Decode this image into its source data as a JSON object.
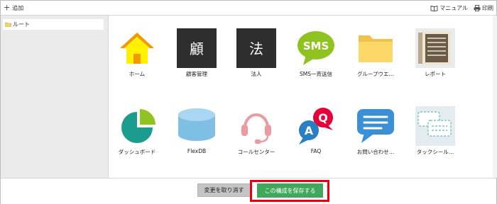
{
  "toolbar": {
    "add_label": "追加",
    "manual_label": "マニュアル",
    "print_label": "印刷"
  },
  "sidebar": {
    "root_label": "ルート"
  },
  "apps": [
    {
      "label": "ホーム",
      "icon": "house-icon"
    },
    {
      "label": "顧客管理",
      "icon": "customer-kanji-icon",
      "glyph": "顧"
    },
    {
      "label": "法人",
      "icon": "corporate-kanji-icon",
      "glyph": "法"
    },
    {
      "label": "SMS一斉送信",
      "icon": "sms-bubble-icon",
      "glyph": "SMS"
    },
    {
      "label": "グループウエ…",
      "icon": "folder-icon"
    },
    {
      "label": "レポート",
      "icon": "report-icon"
    },
    {
      "label": "ダッシュボード",
      "icon": "pie-chart-icon"
    },
    {
      "label": "FlexDB",
      "icon": "database-icon"
    },
    {
      "label": "コールセンター",
      "icon": "headset-icon"
    },
    {
      "label": "FAQ",
      "icon": "faq-bubble-icon",
      "glyph_a": "A",
      "glyph_q": "Q"
    },
    {
      "label": "お問い合わせ…",
      "icon": "chat-bubble-icon"
    },
    {
      "label": "タックシール…",
      "icon": "labels-icon"
    }
  ],
  "footer": {
    "discard_label": "変更を取り消す",
    "save_label": "この構成を保存する"
  },
  "colors": {
    "save_button": "#3fa85c",
    "highlight": "#e60012",
    "kanji_tile": "#2e2e2e"
  }
}
